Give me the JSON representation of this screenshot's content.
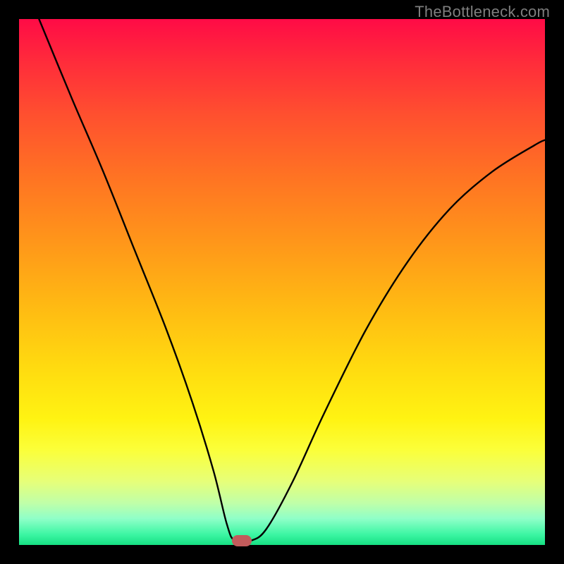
{
  "watermark": "TheBottleneck.com",
  "marker": {
    "x_frac": 0.423,
    "y_frac": 0.992,
    "color": "#c25b5b"
  },
  "chart_data": {
    "type": "line",
    "title": "",
    "xlabel": "",
    "ylabel": "",
    "xlim": [
      0,
      1
    ],
    "ylim": [
      0,
      1
    ],
    "grid": false,
    "legend": false,
    "annotations": [
      "TheBottleneck.com"
    ],
    "series": [
      {
        "name": "curve",
        "x": [
          0.038,
          0.1,
          0.16,
          0.22,
          0.28,
          0.33,
          0.37,
          0.395,
          0.41,
          0.44,
          0.47,
          0.52,
          0.58,
          0.66,
          0.74,
          0.82,
          0.9,
          0.98,
          1.0
        ],
        "y": [
          1.0,
          0.85,
          0.71,
          0.56,
          0.41,
          0.27,
          0.14,
          0.04,
          0.008,
          0.008,
          0.03,
          0.12,
          0.25,
          0.41,
          0.54,
          0.64,
          0.71,
          0.76,
          0.77
        ]
      }
    ],
    "background": {
      "type": "vertical-gradient",
      "stops": [
        {
          "pos": 0.0,
          "color": "#ff0b46"
        },
        {
          "pos": 0.5,
          "color": "#ffb813"
        },
        {
          "pos": 0.8,
          "color": "#fbff3a"
        },
        {
          "pos": 1.0,
          "color": "#16e083"
        }
      ]
    },
    "marker": {
      "x": 0.423,
      "y": 0.008,
      "color": "#c25b5b",
      "shape": "rounded-rect"
    }
  }
}
